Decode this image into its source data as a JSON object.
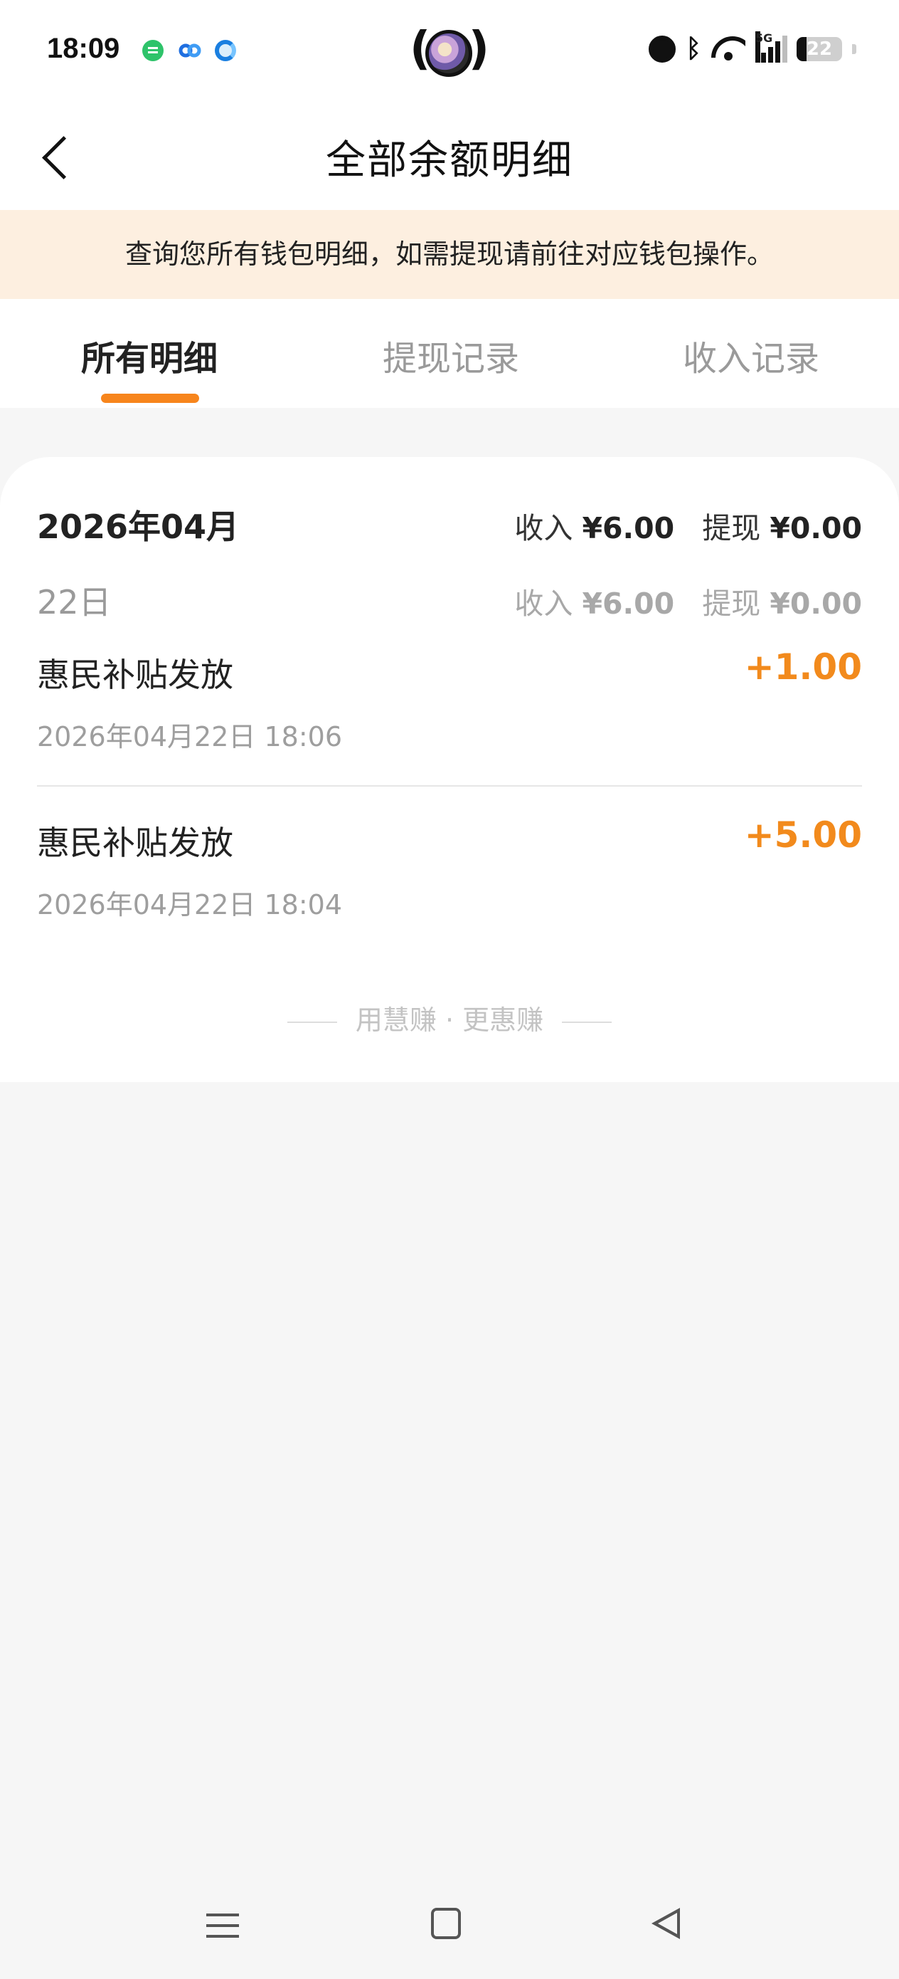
{
  "status_bar": {
    "time": "18:09",
    "network": "5G",
    "battery": "22",
    "battery_level": 0.22,
    "icons": [
      "message-app-icon",
      "cloud-app-icon",
      "browser-app-icon",
      "alarm-icon",
      "bluetooth-icon",
      "wifi-icon",
      "signal-icon",
      "battery-icon"
    ]
  },
  "header": {
    "title": "全部余额明细"
  },
  "notice": {
    "text": "查询您所有钱包明细，如需提现请前往对应钱包操作。"
  },
  "tabs": [
    {
      "label": "所有明细",
      "active": true
    },
    {
      "label": "提现记录",
      "active": false
    },
    {
      "label": "收入记录",
      "active": false
    }
  ],
  "summary": {
    "month": "2026年04月",
    "income_label": "收入",
    "income_value": "¥6.00",
    "withdraw_label": "提现",
    "withdraw_value": "¥0.00"
  },
  "day_group": {
    "day": "22日",
    "income_label": "收入",
    "income_value": "¥6.00",
    "withdraw_label": "提现",
    "withdraw_value": "¥0.00"
  },
  "transactions": [
    {
      "title": "惠民补贴发放",
      "amount": "+1.00",
      "time": "2026年04月22日 18:06"
    },
    {
      "title": "惠民补贴发放",
      "amount": "+5.00",
      "time": "2026年04月22日 18:04"
    }
  ],
  "footer": {
    "slogan": "用慧赚 · 更惠赚"
  },
  "colors": {
    "accent": "#f7851c",
    "amount": "#f28a1c",
    "notice_bg": "#fdefe0",
    "page_bg": "#f6f6f6"
  }
}
